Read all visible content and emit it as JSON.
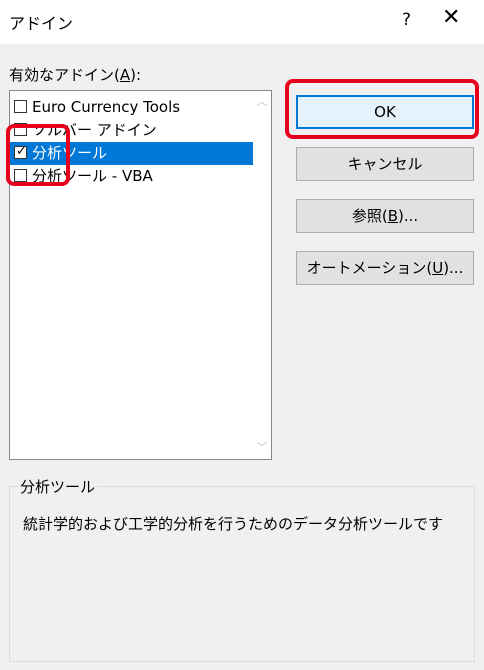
{
  "window": {
    "title": "アドイン",
    "help": "?",
    "close": "✕"
  },
  "list": {
    "label": "有効なアドイン(A):",
    "items": [
      {
        "label": "Euro Currency Tools",
        "checked": false,
        "selected": false
      },
      {
        "label": "ソルバー アドイン",
        "checked": false,
        "selected": false
      },
      {
        "label": "分析ツール",
        "checked": true,
        "selected": true
      },
      {
        "label": "分析ツール - VBA",
        "checked": false,
        "selected": false
      }
    ]
  },
  "buttons": {
    "ok": "OK",
    "cancel": "キャンセル",
    "browse": "参照(B)...",
    "automation": "オートメーション(U)..."
  },
  "description": {
    "group_title": "分析ツール",
    "text": "統計学的および工学的分析を行うためのデータ分析ツールです"
  },
  "colors": {
    "highlight": "#e6001e",
    "selection": "#0078d7"
  }
}
